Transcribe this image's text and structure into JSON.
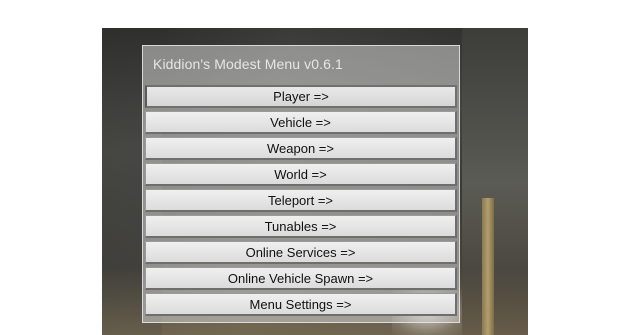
{
  "menu": {
    "title": "Kiddion's Modest Menu v0.6.1",
    "items": [
      {
        "label": "Player =>"
      },
      {
        "label": "Vehicle =>"
      },
      {
        "label": "Weapon =>"
      },
      {
        "label": "World =>"
      },
      {
        "label": "Teleport =>"
      },
      {
        "label": "Tunables =>"
      },
      {
        "label": "Online Services =>"
      },
      {
        "label": "Online Vehicle Spawn =>"
      },
      {
        "label": "Menu Settings =>"
      }
    ]
  },
  "colors": {
    "page_background": "#ffffff",
    "menu_title": "#e6e6e6",
    "item_text": "#111111",
    "item_face": "#e6e6e6"
  }
}
